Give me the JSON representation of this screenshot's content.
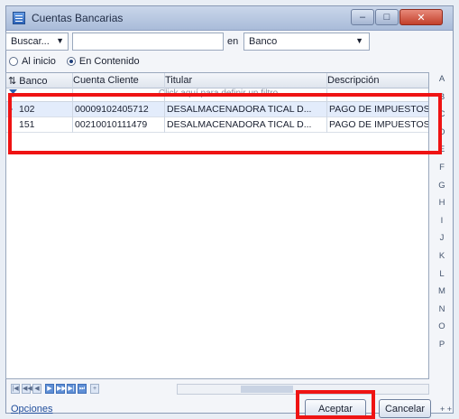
{
  "window": {
    "title": "Cuentas Bancarias"
  },
  "search": {
    "mode_label": "Buscar...",
    "value": "",
    "en_label": "en",
    "field": "Banco"
  },
  "search_options": [
    {
      "label": "Al inicio",
      "selected": false
    },
    {
      "label": "En Contenido",
      "selected": true
    }
  ],
  "grid": {
    "columns": [
      "Banco",
      "Cuenta Cliente",
      "Titular",
      "Descripción"
    ],
    "filter_hint": "Click aquí para definir un filtro",
    "rows": [
      {
        "banco": "102",
        "cuenta": "00009102405712",
        "titular": "DESALMACENADORA TICAL D...",
        "descripcion": "PAGO DE IMPUESTOS"
      },
      {
        "banco": "151",
        "cuenta": "00210010111479",
        "titular": "DESALMACENADORA TICAL D...",
        "descripcion": "PAGO DE IMPUESTOS"
      }
    ]
  },
  "alphabet": [
    "A",
    "B",
    "C",
    "D",
    "E",
    "F",
    "G",
    "H",
    "I",
    "J",
    "K",
    "L",
    "M",
    "N",
    "O",
    "P"
  ],
  "footer": {
    "options_link": "Opciones",
    "ok": "Aceptar",
    "cancel": "Cancelar",
    "more": "+ +"
  },
  "colors": {
    "highlight": "#ef1313",
    "selection": "#e3ecfb"
  }
}
